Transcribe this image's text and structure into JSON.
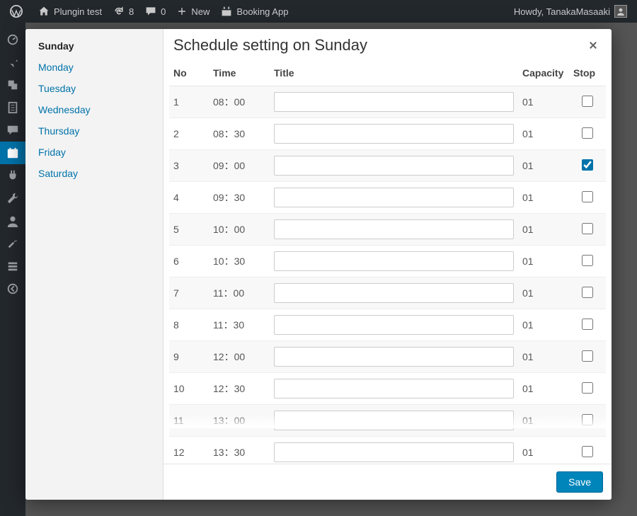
{
  "adminbar": {
    "site_name": "Plungin test",
    "updates": "8",
    "comments": "0",
    "new_label": "New",
    "booking_app_label": "Booking App",
    "howdy": "Howdy, TanakaMasaaki"
  },
  "days": [
    {
      "label": "Sunday",
      "active": true
    },
    {
      "label": "Monday",
      "active": false
    },
    {
      "label": "Tuesday",
      "active": false
    },
    {
      "label": "Wednesday",
      "active": false
    },
    {
      "label": "Thursday",
      "active": false
    },
    {
      "label": "Friday",
      "active": false
    },
    {
      "label": "Saturday",
      "active": false
    }
  ],
  "modal": {
    "title": "Schedule setting on Sunday",
    "columns": {
      "no": "No",
      "time": "Time",
      "title": "Title",
      "capacity": "Capacity",
      "stop": "Stop"
    },
    "save_label": "Save"
  },
  "rows": [
    {
      "no": "1",
      "time": "08：00",
      "title": "",
      "capacity": "01",
      "stop": false
    },
    {
      "no": "2",
      "time": "08：30",
      "title": "",
      "capacity": "01",
      "stop": false
    },
    {
      "no": "3",
      "time": "09：00",
      "title": "",
      "capacity": "01",
      "stop": true
    },
    {
      "no": "4",
      "time": "09：30",
      "title": "",
      "capacity": "01",
      "stop": false
    },
    {
      "no": "5",
      "time": "10：00",
      "title": "",
      "capacity": "01",
      "stop": false
    },
    {
      "no": "6",
      "time": "10：30",
      "title": "",
      "capacity": "01",
      "stop": false
    },
    {
      "no": "7",
      "time": "11：00",
      "title": "",
      "capacity": "01",
      "stop": false
    },
    {
      "no": "8",
      "time": "11：30",
      "title": "",
      "capacity": "01",
      "stop": false
    },
    {
      "no": "9",
      "time": "12：00",
      "title": "",
      "capacity": "01",
      "stop": false
    },
    {
      "no": "10",
      "time": "12：30",
      "title": "",
      "capacity": "01",
      "stop": false
    },
    {
      "no": "11",
      "time": "13：00",
      "title": "",
      "capacity": "01",
      "stop": false
    },
    {
      "no": "12",
      "time": "13：30",
      "title": "",
      "capacity": "01",
      "stop": false
    }
  ],
  "nav_icons": [
    {
      "name": "dashboard-icon",
      "active": false
    },
    {
      "name": "pin-icon",
      "active": false
    },
    {
      "name": "media-icon",
      "active": false
    },
    {
      "name": "pages-icon",
      "active": false
    },
    {
      "name": "comments-icon",
      "active": false
    },
    {
      "name": "calendar-icon",
      "active": true
    },
    {
      "name": "plugin-icon",
      "active": false
    },
    {
      "name": "tools-icon",
      "active": false
    },
    {
      "name": "user-icon",
      "active": false
    },
    {
      "name": "wrench-icon",
      "active": false
    },
    {
      "name": "settings-icon",
      "active": false
    },
    {
      "name": "collapse-icon",
      "active": false
    }
  ]
}
